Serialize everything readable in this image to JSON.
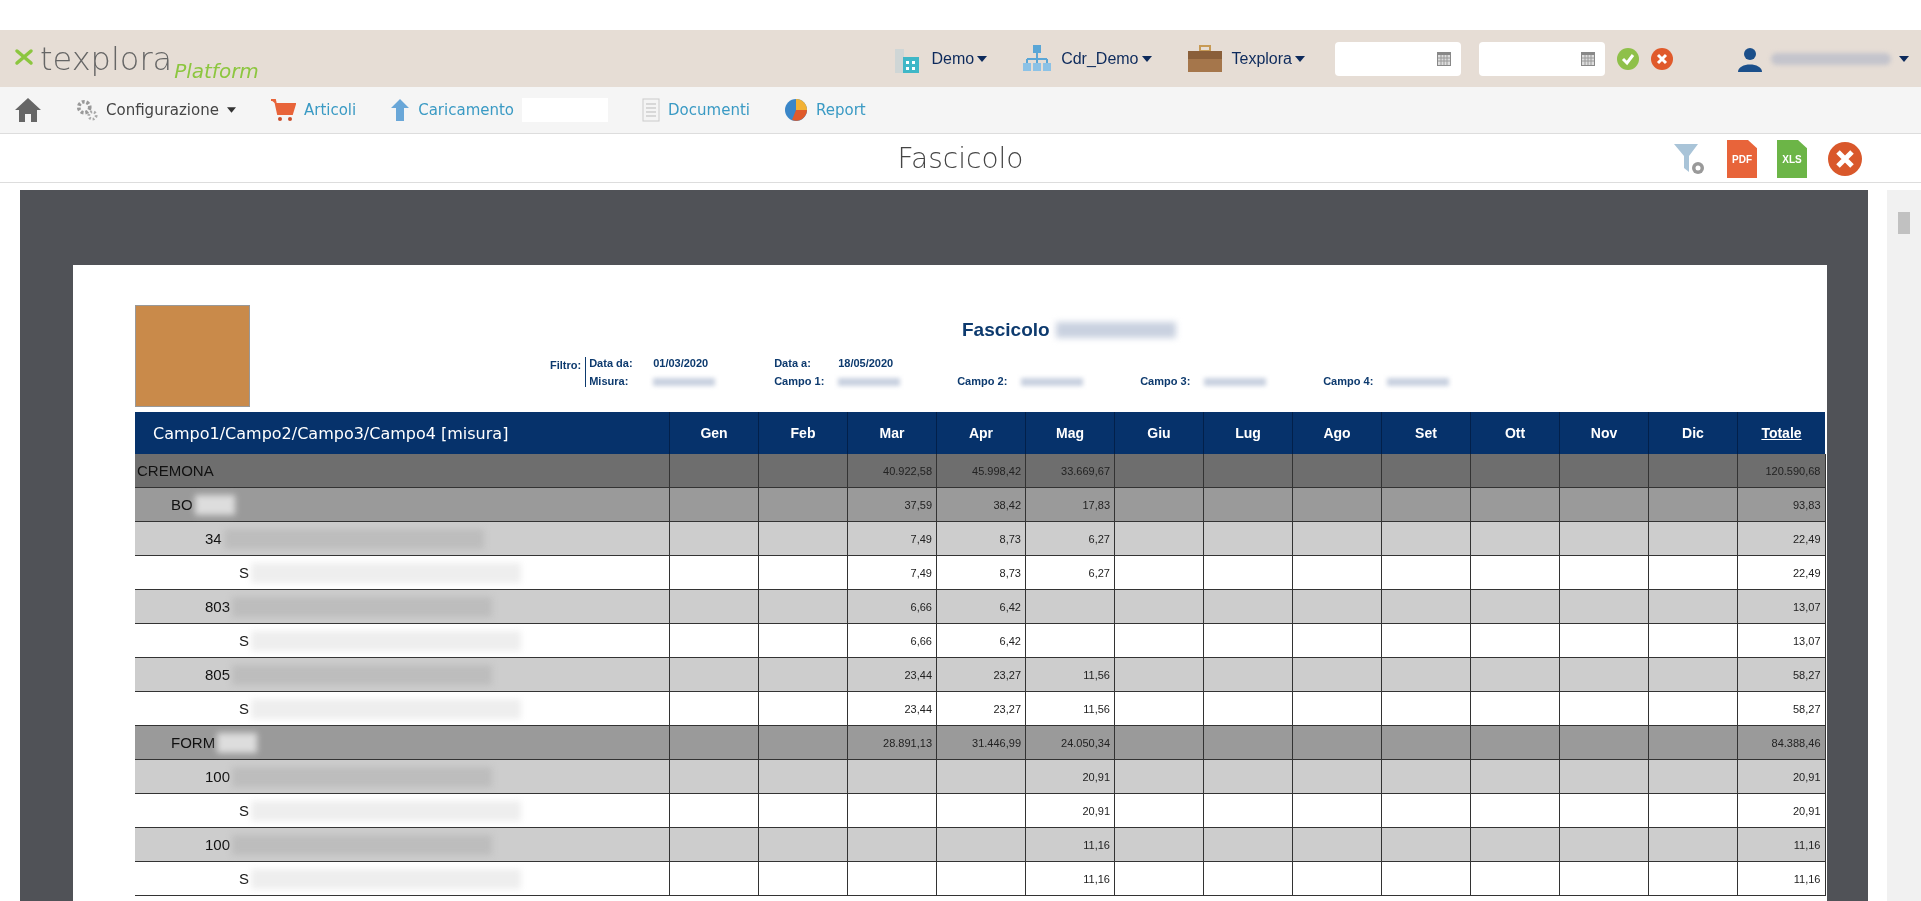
{
  "header": {
    "brand": "texplora",
    "brand_sub": "Platform",
    "selectors": [
      {
        "kind": "building",
        "label": "Demo"
      },
      {
        "kind": "network",
        "label": "Cdr_Demo"
      },
      {
        "kind": "briefcase",
        "label": "Texplora"
      }
    ]
  },
  "nav": [
    {
      "kind": "home"
    },
    {
      "kind": "gears",
      "label": "Configurazione",
      "dropdown": true
    },
    {
      "kind": "cart",
      "label": "Articoli"
    },
    {
      "kind": "upload",
      "label": "Caricamento",
      "redacted": true
    },
    {
      "kind": "document",
      "label": "Documenti"
    },
    {
      "kind": "pie",
      "label": "Report"
    }
  ],
  "page_title": "Fascicolo",
  "actions": [
    {
      "kind": "filter"
    },
    {
      "kind": "pdf",
      "label": "PDF"
    },
    {
      "kind": "xls",
      "label": "XLS"
    },
    {
      "kind": "close"
    }
  ],
  "report": {
    "title": "Fascicolo",
    "filter_label": "Filtro:",
    "filters": [
      [
        {
          "label": "Data da:",
          "value": "01/03/2020"
        },
        {
          "label": "Data a:",
          "value": "18/05/2020"
        }
      ],
      [
        {
          "label": "Misura:"
        },
        {
          "label": "Campo 1:"
        },
        {
          "label": "Campo 2:"
        },
        {
          "label": "Campo 3:"
        },
        {
          "label": "Campo 4:"
        }
      ]
    ],
    "columns": [
      "Campo1/Campo2/Campo3/Campo4 [misura]",
      "Gen",
      "Feb",
      "Mar",
      "Apr",
      "Mag",
      "Giu",
      "Lug",
      "Ago",
      "Set",
      "Ott",
      "Nov",
      "Dic",
      "Totale"
    ],
    "rows": [
      {
        "label": "CREMONA",
        "mar": "40.922,58",
        "apr": "45.998,42",
        "mag": "33.669,67",
        "total": "120.590,68",
        "children": [
          {
            "label": "BO",
            "redacted": true,
            "mar": "37,59",
            "apr": "38,42",
            "mag": "17,83",
            "total": "93,83",
            "children": [
              {
                "label": "34",
                "redacted": true,
                "mar": "7,49",
                "apr": "8,73",
                "mag": "6,27",
                "total": "22,49",
                "children": [
                  {
                    "label": "S",
                    "redacted": true,
                    "mar": "7,49",
                    "apr": "8,73",
                    "mag": "6,27",
                    "total": "22,49"
                  }
                ]
              },
              {
                "label": "803",
                "redacted": true,
                "mar": "6,66",
                "apr": "6,42",
                "total": "13,07",
                "children": [
                  {
                    "label": "S",
                    "redacted": true,
                    "mar": "6,66",
                    "apr": "6,42",
                    "total": "13,07"
                  }
                ]
              },
              {
                "label": "805",
                "redacted": true,
                "mar": "23,44",
                "apr": "23,27",
                "mag": "11,56",
                "total": "58,27",
                "children": [
                  {
                    "label": "S",
                    "redacted": true,
                    "mar": "23,44",
                    "apr": "23,27",
                    "mag": "11,56",
                    "total": "58,27"
                  }
                ]
              }
            ]
          },
          {
            "label": "FORM",
            "redacted": true,
            "mar": "28.891,13",
            "apr": "31.446,99",
            "mag": "24.050,34",
            "total": "84.388,46",
            "children": [
              {
                "label": "100",
                "redacted": true,
                "mag": "20,91",
                "total": "20,91",
                "children": [
                  {
                    "label": "S",
                    "redacted": true,
                    "mag": "20,91",
                    "total": "20,91"
                  }
                ]
              },
              {
                "label": "100",
                "redacted": true,
                "mag": "11,16",
                "total": "11,16",
                "children": [
                  {
                    "label": "S",
                    "redacted": true,
                    "mag": "11,16",
                    "total": "11,16"
                  }
                ]
              }
            ]
          }
        ]
      }
    ]
  }
}
